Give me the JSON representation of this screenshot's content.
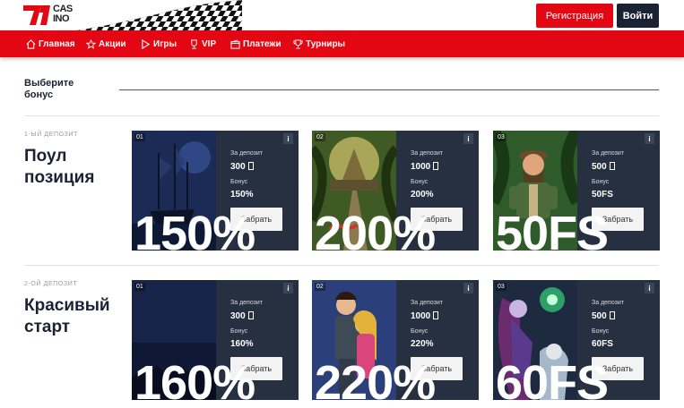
{
  "header": {
    "logo_text": "CAS\nINO",
    "logo_mark": "71",
    "register_label": "Регистрация",
    "login_label": "Войти",
    "brand_red": "#e30613",
    "dark": "#1b2233"
  },
  "nav": [
    {
      "label": "Главная",
      "icon": "home-icon"
    },
    {
      "label": "Акции",
      "icon": "star-icon"
    },
    {
      "label": "Игры",
      "icon": "play-icon"
    },
    {
      "label": "VIP",
      "icon": "trophy-icon"
    },
    {
      "label": "Платежи",
      "icon": "wallet-icon"
    },
    {
      "label": "Турниры",
      "icon": "cup-icon"
    }
  ],
  "choose_label": "Выберите бонус",
  "sections": [
    {
      "label": "1-ЫЙ ДЕПОЗИТ",
      "title": "Поул позиция",
      "cards": [
        {
          "num": "01",
          "deposit_label": "За депозит",
          "deposit": "300",
          "bonus_label": "Бонус",
          "bonus": "150%",
          "button": "Забрать",
          "big": "150%",
          "image": "ghost-ship"
        },
        {
          "num": "02",
          "deposit_label": "За депозит",
          "deposit": "1000",
          "bonus_label": "Бонус",
          "bonus": "200%",
          "button": "Забрать",
          "big": "200%",
          "image": "jungle-temple"
        },
        {
          "num": "03",
          "deposit_label": "За депозит",
          "deposit": "500",
          "bonus_label": "Бонус",
          "bonus": "50FS",
          "button": "Забрать",
          "big": "50FS",
          "image": "explorer"
        }
      ]
    },
    {
      "label": "2-ОЙ ДЕПОЗИТ",
      "title": "Красивый старт",
      "cards": [
        {
          "num": "01",
          "deposit_label": "За депозит",
          "deposit": "300",
          "bonus_label": "Бонус",
          "bonus": "160%",
          "button": "Забрать",
          "big": "160%",
          "image": "night-sky"
        },
        {
          "num": "02",
          "deposit_label": "За депозит",
          "deposit": "1000",
          "bonus_label": "Бонус",
          "bonus": "220%",
          "button": "Забрать",
          "big": "220%",
          "image": "knight-princess"
        },
        {
          "num": "03",
          "deposit_label": "За депозит",
          "deposit": "500",
          "bonus_label": "Бонус",
          "bonus": "60FS",
          "button": "Забрать",
          "big": "60FS",
          "image": "witch"
        }
      ]
    }
  ]
}
